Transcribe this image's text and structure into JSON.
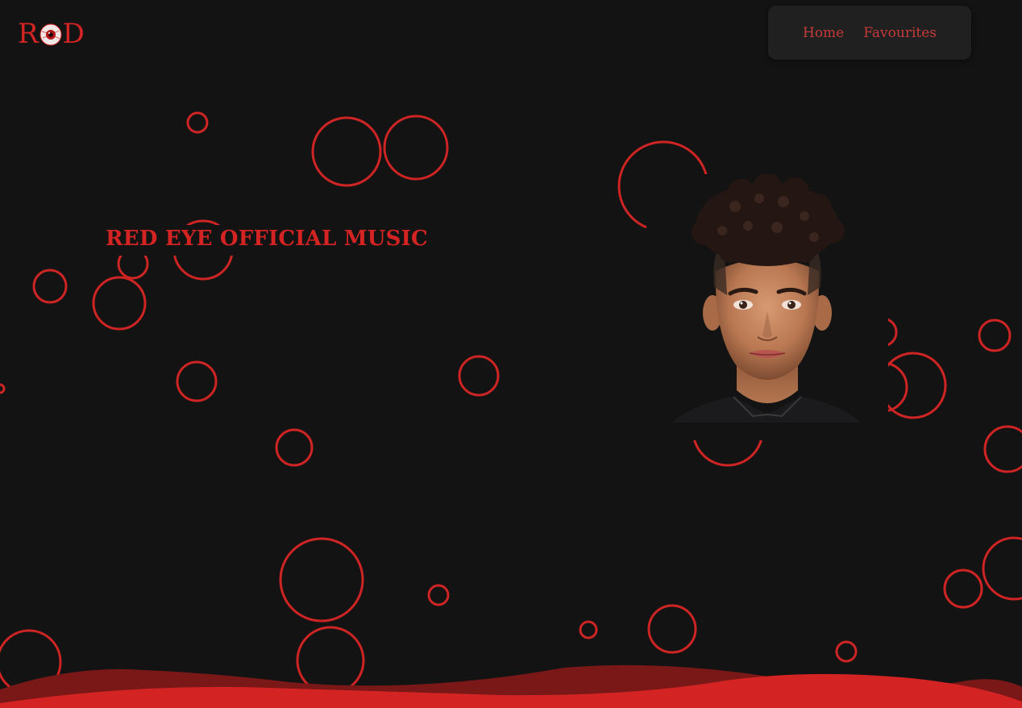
{
  "header": {
    "logo": {
      "left_letter": "R",
      "right_letter": "D",
      "eye_icon": "eyeball-icon"
    },
    "nav": {
      "items": [
        {
          "label": "Home"
        },
        {
          "label": "Favourites"
        }
      ]
    }
  },
  "hero": {
    "title": "RED EYE OFFICIAL MUSIC",
    "portrait": "artist-portrait"
  },
  "theme": {
    "background": "#131313",
    "accent": "#d42323",
    "nav_background": "#202020",
    "wave_dark": "#7a1818",
    "wave_bright": "#d42323"
  }
}
